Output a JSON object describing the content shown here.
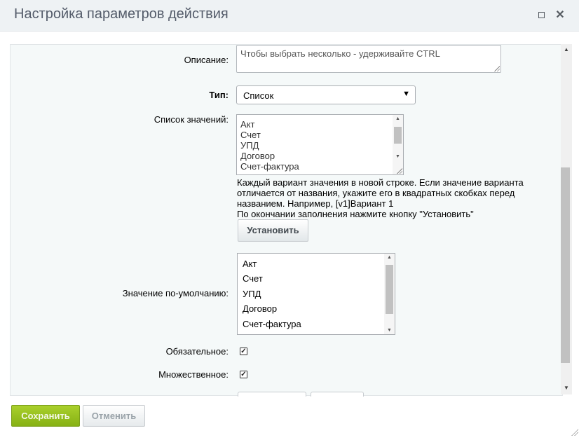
{
  "dialog": {
    "title": "Настройка параметров действия"
  },
  "form": {
    "description": {
      "label": "Описание:",
      "value": "Чтобы выбрать несколько - удерживайте CTRL"
    },
    "type": {
      "label": "Тип:",
      "selected": "Список"
    },
    "values_list": {
      "label": "Список значений:",
      "items": [
        "Акт",
        "Счет",
        "УПД",
        "Договор",
        "Счет-фактура"
      ],
      "help": [
        "Каждый вариант значения в новой строке. Если значение варианта",
        "отличается от названия, укажите его в квадратных скобках перед",
        "названием. Например, [v1]Вариант 1",
        "По окончании заполнения нажмите кнопку \"Установить\""
      ],
      "apply_button": "Установить"
    },
    "default_value": {
      "label": "Значение по-умолчанию:",
      "items": [
        "Акт",
        "Счет",
        "УПД",
        "Договор",
        "Счет-фактура"
      ]
    },
    "required": {
      "label": "Обязательное:",
      "checked": true
    },
    "multiple": {
      "label": "Множественное:",
      "checked": true
    }
  },
  "footer": {
    "save_label": "Сохранить",
    "cancel_label": "Отменить"
  },
  "colors": {
    "save_button": "#8cb51a",
    "titlebar": "#eef2f4",
    "content_bg": "#f5f9f9"
  }
}
